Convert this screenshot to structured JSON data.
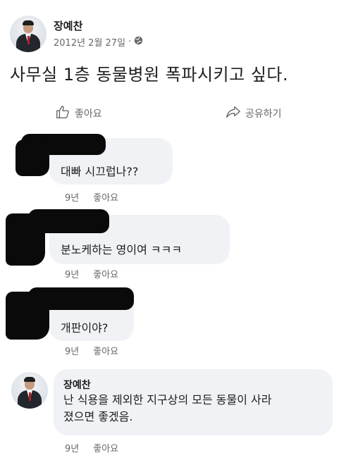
{
  "post": {
    "author": "장예찬",
    "date": "2012년 2월 27일",
    "separator": "·",
    "privacy_icon": "globe-icon",
    "text": "사무실 1층 동물병원 폭파시키고 싶다."
  },
  "actions": {
    "like_label": "좋아요",
    "share_label": "공유하기",
    "like_icon": "thumbs-up-icon",
    "share_icon": "share-arrow-icon"
  },
  "comments": [
    {
      "author_redacted": true,
      "text": "대빠 시끄럽나??",
      "age": "9년",
      "like_label": "좋아요"
    },
    {
      "author_redacted": true,
      "text": "분노케하는 영이여  ㅋㅋㅋ",
      "age": "9년",
      "like_label": "좋아요"
    },
    {
      "author_redacted": true,
      "text": "개판이야?",
      "age": "9년",
      "like_label": "좋아요"
    },
    {
      "author": "장예찬",
      "text_line1": "난 식용을 제외한 지구상의 모든 동물이 사라",
      "text_line2": "졌으면 좋겠음.",
      "age": "9년",
      "like_label": "좋아요"
    }
  ],
  "colors": {
    "text_primary": "#1c1e21",
    "text_secondary": "#65676b",
    "bubble_bg": "#f0f2f5",
    "redaction": "#0a0a0a"
  }
}
